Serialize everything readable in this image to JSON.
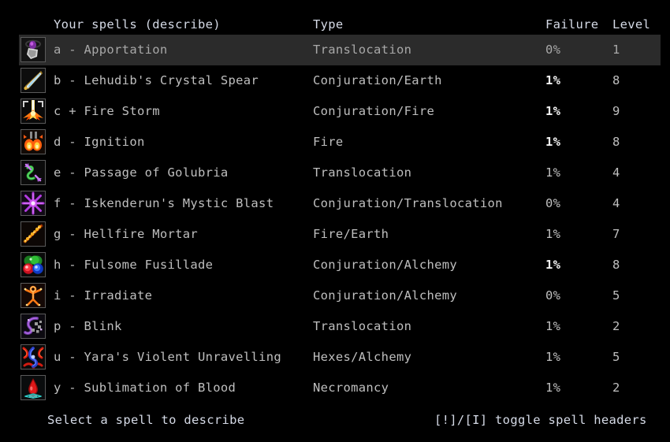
{
  "header": {
    "name_label": "Your spells (describe)",
    "type_label": "Type",
    "failure_label": "Failure",
    "level_label": "Level"
  },
  "footer": {
    "left_hint": "Select a spell to describe",
    "right_hint": "[!]/[I] toggle spell headers"
  },
  "colors": {
    "background": "#000000",
    "header_text": "#d5dae6",
    "row_text": "#bfbfbf",
    "row_text_bold": "#f2f2f2",
    "selected_background": "#2b2b2b",
    "selected_text": "#a8a8a8",
    "icon_border": "#5a5a5a"
  },
  "spells": [
    {
      "letter": "a",
      "marker": "-",
      "label": "a - Apportation",
      "name": "Apportation",
      "type": "Translocation",
      "failure": "0%",
      "failure_bold": false,
      "level": "1",
      "selected": true,
      "icon": "apportation-icon"
    },
    {
      "letter": "b",
      "marker": "-",
      "label": "b - Lehudib's Crystal Spear",
      "name": "Lehudib's Crystal Spear",
      "type": "Conjuration/Earth",
      "failure": "1%",
      "failure_bold": true,
      "level": "8",
      "selected": false,
      "icon": "crystal-spear-icon"
    },
    {
      "letter": "c",
      "marker": "+",
      "label": "c + Fire Storm",
      "name": "Fire Storm",
      "type": "Conjuration/Fire",
      "failure": "1%",
      "failure_bold": true,
      "level": "9",
      "selected": false,
      "icon": "fire-storm-icon"
    },
    {
      "letter": "d",
      "marker": "-",
      "label": "d - Ignition",
      "name": "Ignition",
      "type": "Fire",
      "failure": "1%",
      "failure_bold": true,
      "level": "8",
      "selected": false,
      "icon": "ignition-icon"
    },
    {
      "letter": "e",
      "marker": "-",
      "label": "e - Passage of Golubria",
      "name": "Passage of Golubria",
      "type": "Translocation",
      "failure": "1%",
      "failure_bold": false,
      "level": "4",
      "selected": false,
      "icon": "passage-of-golubria-icon"
    },
    {
      "letter": "f",
      "marker": "-",
      "label": "f - Iskenderun's Mystic Blast",
      "name": "Iskenderun's Mystic Blast",
      "type": "Conjuration/Translocation",
      "failure": "0%",
      "failure_bold": false,
      "level": "4",
      "selected": false,
      "icon": "mystic-blast-icon"
    },
    {
      "letter": "g",
      "marker": "-",
      "label": "g - Hellfire Mortar",
      "name": "Hellfire Mortar",
      "type": "Fire/Earth",
      "failure": "1%",
      "failure_bold": false,
      "level": "7",
      "selected": false,
      "icon": "hellfire-mortar-icon"
    },
    {
      "letter": "h",
      "marker": "-",
      "label": "h - Fulsome Fusillade",
      "name": "Fulsome Fusillade",
      "type": "Conjuration/Alchemy",
      "failure": "1%",
      "failure_bold": true,
      "level": "8",
      "selected": false,
      "icon": "fulsome-fusillade-icon"
    },
    {
      "letter": "i",
      "marker": "-",
      "label": "i - Irradiate",
      "name": "Irradiate",
      "type": "Conjuration/Alchemy",
      "failure": "0%",
      "failure_bold": false,
      "level": "5",
      "selected": false,
      "icon": "irradiate-icon"
    },
    {
      "letter": "p",
      "marker": "-",
      "label": "p - Blink",
      "name": "Blink",
      "type": "Translocation",
      "failure": "1%",
      "failure_bold": false,
      "level": "2",
      "selected": false,
      "icon": "blink-icon"
    },
    {
      "letter": "u",
      "marker": "-",
      "label": "u - Yara's Violent Unravelling",
      "name": "Yara's Violent Unravelling",
      "type": "Hexes/Alchemy",
      "failure": "1%",
      "failure_bold": false,
      "level": "5",
      "selected": false,
      "icon": "yaras-violent-unravelling-icon"
    },
    {
      "letter": "y",
      "marker": "-",
      "label": "y - Sublimation of Blood",
      "name": "Sublimation of Blood",
      "type": "Necromancy",
      "failure": "1%",
      "failure_bold": false,
      "level": "2",
      "selected": false,
      "icon": "sublimation-of-blood-icon"
    }
  ]
}
